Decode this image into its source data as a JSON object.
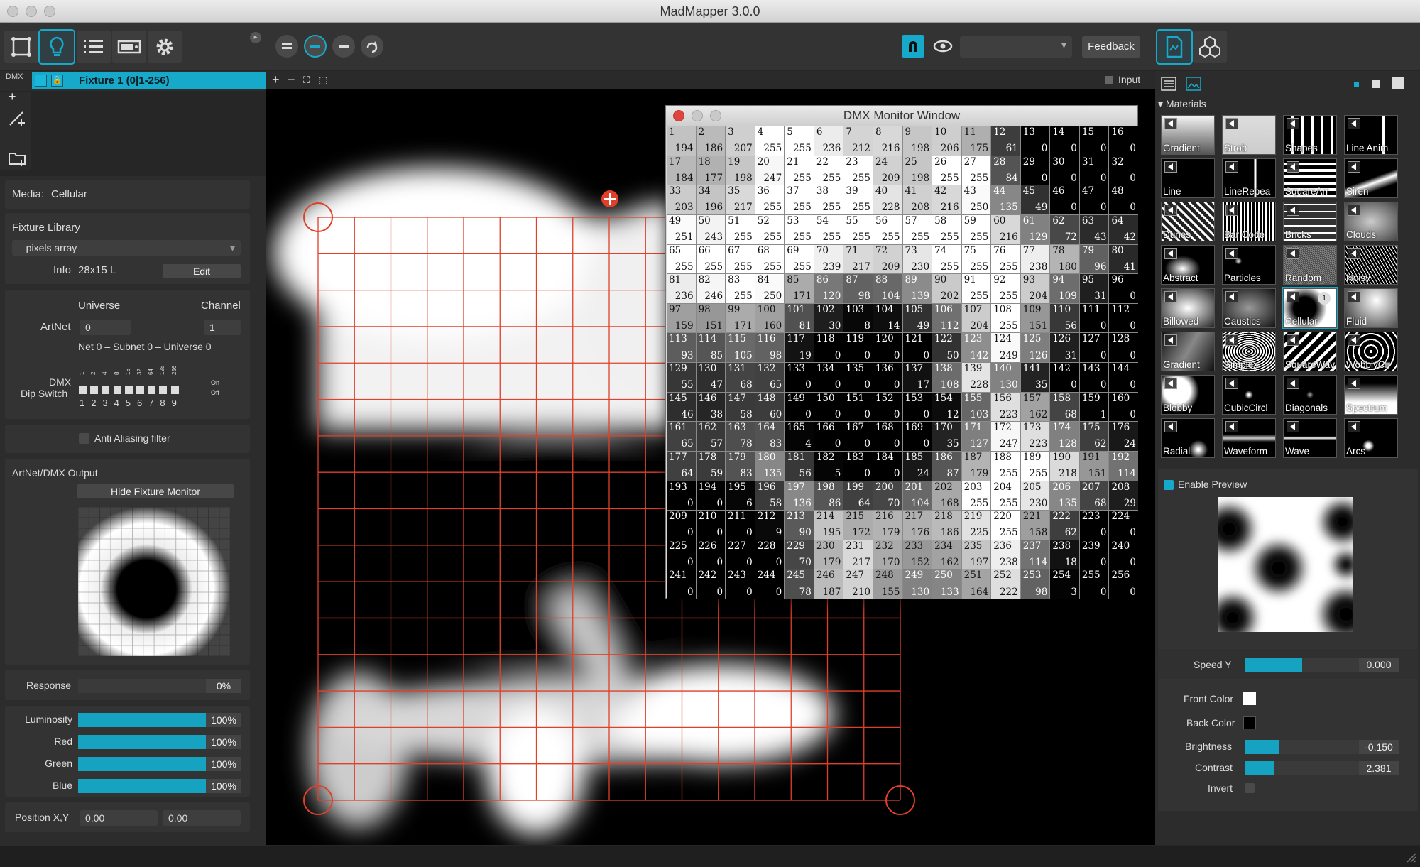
{
  "app": {
    "title": "MadMapper 3.0.0"
  },
  "toolbar": {
    "feedback_label": "Feedback",
    "colors": {
      "accent": "#17a9c9"
    }
  },
  "fixture_tab": {
    "label": "Fixture 1 (0|1-256)",
    "dmx_label": "DMX"
  },
  "canvas": {
    "input_label": "Input"
  },
  "left": {
    "media_label": "Media:",
    "media_value": "Cellular",
    "fixture_library_label": "Fixture Library",
    "library_value": "– pixels array",
    "info_label": "Info",
    "info_value": "28x15 L",
    "edit_label": "Edit",
    "universe_label": "Universe",
    "channel_label": "Channel",
    "artnet_label": "ArtNet",
    "universe_value": "0",
    "channel_value": "1",
    "net_text": "Net 0 – Subnet 0 – Universe 0",
    "dmx_label": "DMX",
    "dip_label": "Dip Switch",
    "dip_values": [
      "1",
      "2",
      "4",
      "8",
      "16",
      "32",
      "64",
      "128",
      "256"
    ],
    "dip_numbers": [
      "1",
      "2",
      "3",
      "4",
      "5",
      "6",
      "7",
      "8",
      "9"
    ],
    "on_label": "On",
    "off_label": "Off",
    "anti_alias_label": "Anti Aliasing filter",
    "output_label": "ArtNet/DMX Output",
    "hide_monitor_label": "Hide Fixture Monitor",
    "response_label": "Response",
    "response_value": "0%",
    "response_level": 0,
    "sliders": [
      {
        "label": "Luminosity",
        "value": "100%",
        "level": 1
      },
      {
        "label": "Red",
        "value": "100%",
        "level": 1
      },
      {
        "label": "Green",
        "value": "100%",
        "level": 1
      },
      {
        "label": "Blue",
        "value": "100%",
        "level": 1
      }
    ],
    "position_label": "Position X,Y",
    "pos_x": "0.00",
    "pos_y": "0.00"
  },
  "dmx": {
    "title": "DMX Monitor Window",
    "values": [
      194,
      186,
      207,
      255,
      255,
      236,
      212,
      216,
      198,
      206,
      175,
      61,
      0,
      0,
      0,
      0,
      184,
      177,
      198,
      247,
      255,
      255,
      255,
      209,
      198,
      255,
      255,
      84,
      0,
      0,
      0,
      0,
      203,
      196,
      217,
      255,
      255,
      255,
      255,
      228,
      208,
      216,
      250,
      135,
      49,
      0,
      0,
      0,
      251,
      243,
      255,
      255,
      255,
      255,
      255,
      255,
      255,
      255,
      255,
      216,
      129,
      72,
      43,
      42,
      255,
      255,
      255,
      255,
      255,
      239,
      217,
      209,
      230,
      255,
      255,
      255,
      238,
      180,
      96,
      41,
      236,
      246,
      255,
      250,
      171,
      120,
      98,
      104,
      139,
      202,
      255,
      255,
      204,
      109,
      31,
      0,
      159,
      151,
      171,
      160,
      81,
      30,
      8,
      14,
      49,
      112,
      204,
      255,
      151,
      56,
      0,
      0,
      93,
      85,
      105,
      98,
      19,
      0,
      0,
      0,
      0,
      50,
      142,
      249,
      126,
      31,
      0,
      0,
      55,
      47,
      68,
      65,
      0,
      0,
      0,
      0,
      17,
      108,
      228,
      130,
      35,
      0,
      0,
      0,
      46,
      38,
      58,
      60,
      0,
      0,
      0,
      0,
      0,
      12,
      103,
      223,
      162,
      68,
      1,
      0,
      65,
      57,
      78,
      83,
      4,
      0,
      0,
      0,
      0,
      35,
      127,
      247,
      223,
      128,
      62,
      24,
      64,
      59,
      83,
      135,
      56,
      5,
      0,
      0,
      24,
      87,
      179,
      255,
      255,
      218,
      151,
      114,
      0,
      0,
      6,
      58,
      136,
      86,
      64,
      70,
      104,
      168,
      255,
      255,
      230,
      135,
      68,
      29,
      0,
      0,
      0,
      9,
      90,
      195,
      172,
      179,
      176,
      186,
      225,
      255,
      158,
      62,
      0,
      0,
      0,
      0,
      0,
      0,
      70,
      179,
      217,
      170,
      152,
      162,
      197,
      238,
      114,
      18,
      0,
      0,
      0,
      0,
      0,
      0,
      78,
      187,
      210,
      155,
      130,
      133,
      164,
      222,
      98,
      3,
      0,
      0
    ]
  },
  "right": {
    "materials_label": "Materials",
    "materials": [
      {
        "label": "Gradient"
      },
      {
        "label": "Strob"
      },
      {
        "label": "Shapes"
      },
      {
        "label": "Line Anim"
      },
      {
        "label": "Line"
      },
      {
        "label": "LineRepea"
      },
      {
        "label": "SquareArr"
      },
      {
        "label": "Siren"
      },
      {
        "label": "Dunes"
      },
      {
        "label": "Bar Code"
      },
      {
        "label": "Bricks"
      },
      {
        "label": "Clouds"
      },
      {
        "label": "Abstract"
      },
      {
        "label": "Particles"
      },
      {
        "label": "Random"
      },
      {
        "label": "Noisy"
      },
      {
        "label": "Billowed"
      },
      {
        "label": "Caustics"
      },
      {
        "label": "Cellular",
        "badge": "1"
      },
      {
        "label": "Fluid"
      },
      {
        "label": "Gradient"
      },
      {
        "label": "Simplex"
      },
      {
        "label": "SquareWav"
      },
      {
        "label": "WobblyCir"
      },
      {
        "label": "Blobby"
      },
      {
        "label": "CubicCircl"
      },
      {
        "label": "Diagonals"
      },
      {
        "label": "Spectrum"
      },
      {
        "label": "Radial"
      },
      {
        "label": "Waveform"
      },
      {
        "label": "Wave"
      },
      {
        "label": "Arcs"
      }
    ],
    "enable_preview_label": "Enable Preview",
    "speed_y_label": "Speed Y",
    "speed_y_value": "0.000",
    "speed_y_level": 0.5,
    "front_color_label": "Front Color",
    "front_color": "#ffffff",
    "back_color_label": "Back Color",
    "back_color": "#000000",
    "brightness_label": "Brightness",
    "brightness_value": "-0.150",
    "brightness_level": 0.3,
    "contrast_label": "Contrast",
    "contrast_value": "2.381",
    "contrast_level": 0.25,
    "invert_label": "Invert"
  }
}
